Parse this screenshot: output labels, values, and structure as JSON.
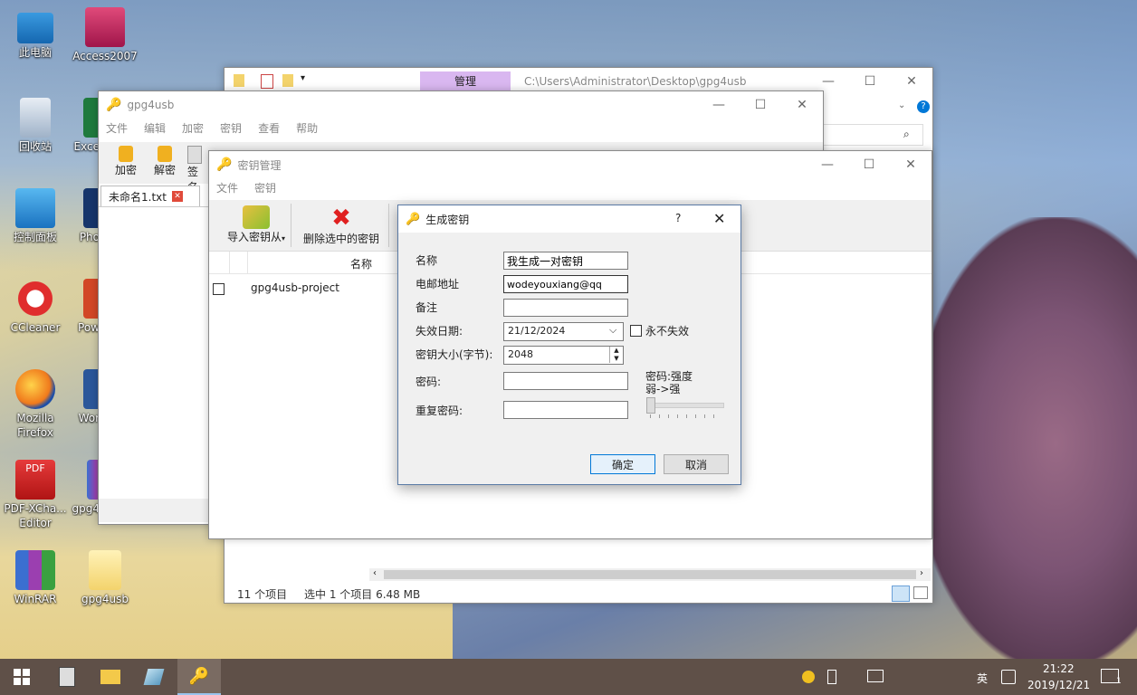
{
  "desktop": {
    "icons": [
      {
        "label": "此电脑"
      },
      {
        "label": "Access2007"
      },
      {
        "label": "回收站"
      },
      {
        "label": "Exce"
      },
      {
        "label": "控制面板"
      },
      {
        "label": "Pho"
      },
      {
        "label": "CCleaner"
      },
      {
        "label": "Pow"
      },
      {
        "label": "Mozilla Firefox"
      },
      {
        "label": "Wor"
      },
      {
        "label": "PDF-XCha... Editor"
      },
      {
        "label": "gpg4"
      },
      {
        "label": "WinRAR"
      },
      {
        "label": "gpg4usb"
      }
    ]
  },
  "explorer": {
    "ribbon_tab": "管理",
    "path": "C:\\Users\\Administrator\\Desktop\\gpg4usb",
    "status_items": "11 个项目",
    "status_selected": "选中 1 个项目  6.48 MB"
  },
  "gpg_main": {
    "title": "gpg4usb",
    "menu": [
      "文件",
      "编辑",
      "加密",
      "密钥",
      "查看",
      "帮助"
    ],
    "toolbar": [
      "加密",
      "解密",
      "签名"
    ],
    "tab": "未命名1.txt"
  },
  "key_manager": {
    "title": "密钥管理",
    "menu": [
      "文件",
      "密钥"
    ],
    "import_label": "导入密钥从",
    "delete_label": "删除选中的密钥",
    "column_name": "名称",
    "rows": [
      {
        "name": "gpg4usb-project",
        "checked": false
      }
    ]
  },
  "dialog": {
    "title": "生成密钥",
    "help": "?",
    "name_label": "名称",
    "name_value": "我生成一对密钥",
    "email_label": "电邮地址",
    "email_value": "wodeyouxiang@qq",
    "comment_label": "备注",
    "comment_value": "",
    "expire_label": "失效日期:",
    "expire_value": "21/12/2024",
    "never_expire_label": "永不失效",
    "never_expire_checked": false,
    "keysize_label": "密钥大小(字节):",
    "keysize_value": "2048",
    "password_label": "密码:",
    "repeat_label": "重复密码:",
    "strength_label": "密码:强度",
    "strength_range": "弱->强",
    "strength_level": 0,
    "ok": "确定",
    "cancel": "取消"
  },
  "taskbar": {
    "ime": "英",
    "time": "21:22",
    "date": "2019/12/21",
    "notifications": "1"
  },
  "colors": {
    "accent": "#0078d7",
    "ribbon_manage": "#d9b7f0",
    "delete_red": "#e02020",
    "taskbar": "#5f5048"
  }
}
